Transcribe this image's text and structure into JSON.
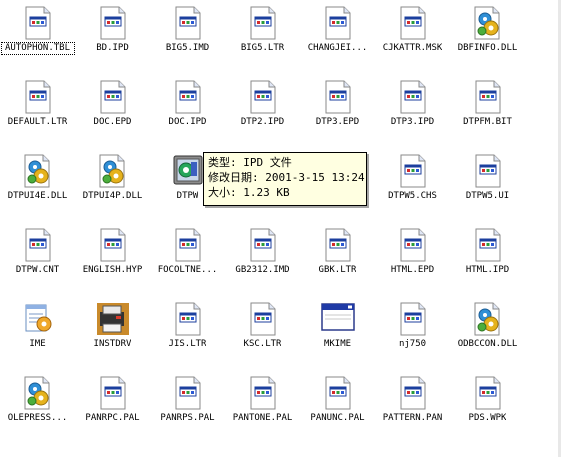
{
  "files": [
    {
      "name": "AUTOPHON.TBL",
      "icon": "document-icon"
    },
    {
      "name": "BD.IPD",
      "icon": "document-icon"
    },
    {
      "name": "BIG5.IMD",
      "icon": "document-icon"
    },
    {
      "name": "BIG5.LTR",
      "icon": "document-icon"
    },
    {
      "name": "CHANGJEI...",
      "icon": "document-icon"
    },
    {
      "name": "CJKATTR.MSK",
      "icon": "document-icon"
    },
    {
      "name": "DBFINFO.DLL",
      "icon": "dll-gear-icon"
    },
    {
      "name": "DEFAULT.LTR",
      "icon": "document-icon"
    },
    {
      "name": "DOC.EPD",
      "icon": "document-icon"
    },
    {
      "name": "DOC.IPD",
      "icon": "document-icon"
    },
    {
      "name": "DTP2.IPD",
      "icon": "document-icon"
    },
    {
      "name": "DTP3.EPD",
      "icon": "document-icon"
    },
    {
      "name": "DTP3.IPD",
      "icon": "document-icon"
    },
    {
      "name": "DTPFM.BIT",
      "icon": "document-icon"
    },
    {
      "name": "DTPUI4E.DLL",
      "icon": "dll-gear-icon"
    },
    {
      "name": "DTPUI4P.DLL",
      "icon": "dll-gear-icon"
    },
    {
      "name": "DTPW",
      "icon": "ime-setup-icon"
    },
    {
      "name": "",
      "icon": "document-icon"
    },
    {
      "name": "",
      "icon": "document-icon"
    },
    {
      "name": "DTPW5.CHS",
      "icon": "document-icon"
    },
    {
      "name": "DTPW5.UI",
      "icon": "document-icon"
    },
    {
      "name": "DTPW.CNT",
      "icon": "document-icon"
    },
    {
      "name": "ENGLISH.HYP",
      "icon": "document-icon"
    },
    {
      "name": "FOCOLTNE...",
      "icon": "document-icon"
    },
    {
      "name": "GB2312.IMD",
      "icon": "document-icon"
    },
    {
      "name": "GBK.LTR",
      "icon": "document-icon"
    },
    {
      "name": "HTML.EPD",
      "icon": "document-icon"
    },
    {
      "name": "HTML.IPD",
      "icon": "document-icon"
    },
    {
      "name": "IME",
      "icon": "notepad-gear-icon"
    },
    {
      "name": "INSTDRV",
      "icon": "printer-installer-icon"
    },
    {
      "name": "JIS.LTR",
      "icon": "document-icon"
    },
    {
      "name": "KSC.LTR",
      "icon": "document-icon"
    },
    {
      "name": "MKIME",
      "icon": "window-app-icon"
    },
    {
      "name": "nj750",
      "icon": "document-icon"
    },
    {
      "name": "ODBCCON.DLL",
      "icon": "dll-gear-icon"
    },
    {
      "name": "OLEPRESS...",
      "icon": "dll-gear-icon"
    },
    {
      "name": "PANRPC.PAL",
      "icon": "document-icon"
    },
    {
      "name": "PANRPS.PAL",
      "icon": "document-icon"
    },
    {
      "name": "PANTONE.PAL",
      "icon": "document-icon"
    },
    {
      "name": "PANUNC.PAL",
      "icon": "document-icon"
    },
    {
      "name": "PATTERN.PAN",
      "icon": "document-icon"
    },
    {
      "name": "PDS.WPK",
      "icon": "document-icon"
    }
  ],
  "tooltip": {
    "line1": "类型: IPD 文件",
    "line2": "修改日期:  2001-3-15 13:24",
    "line3": "大小: 1.23 KB"
  },
  "colors": {
    "tooltip_bg": "#ffffe1",
    "page_fold": "#dfe6f5",
    "doc_bar": "#1c3f9e"
  }
}
